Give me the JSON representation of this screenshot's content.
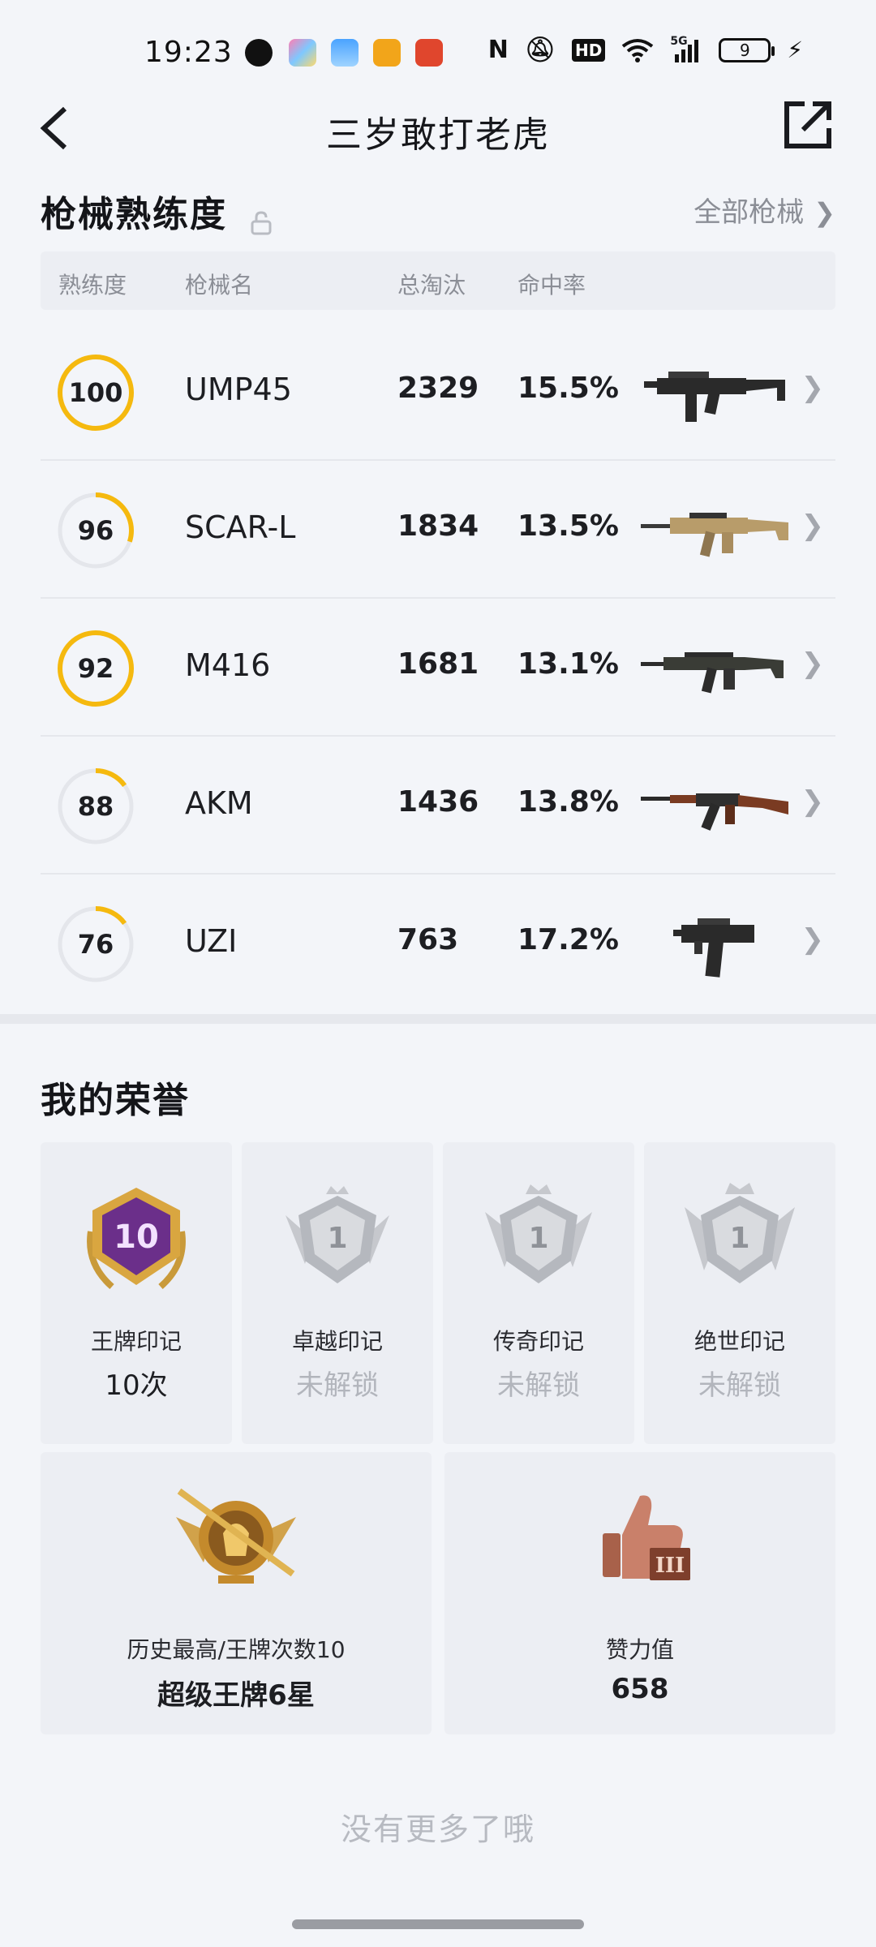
{
  "status_bar": {
    "time": "19:23",
    "hd": "HD",
    "net": "5G",
    "battery": "9"
  },
  "header": {
    "title": "三岁敢打老虎"
  },
  "mastery": {
    "title": "枪械熟练度",
    "all_link": "全部枪械",
    "columns": {
      "mastery": "熟练度",
      "name": "枪械名",
      "kills": "总淘汰",
      "hit_rate": "命中率"
    },
    "rows": [
      {
        "level": "100",
        "level_fraction": 1.0,
        "name": "UMP45",
        "kills": "2329",
        "hit_rate": "15.5%",
        "icon": "smg-ump45-icon"
      },
      {
        "level": "96",
        "level_fraction": 0.3,
        "name": "SCAR-L",
        "kills": "1834",
        "hit_rate": "13.5%",
        "icon": "rifle-scar-icon"
      },
      {
        "level": "92",
        "level_fraction": 1.0,
        "name": "M416",
        "kills": "1681",
        "hit_rate": "13.1%",
        "icon": "rifle-m416-icon"
      },
      {
        "level": "88",
        "level_fraction": 0.15,
        "name": "AKM",
        "kills": "1436",
        "hit_rate": "13.8%",
        "icon": "rifle-akm-icon"
      },
      {
        "level": "76",
        "level_fraction": 0.15,
        "name": "UZI",
        "kills": "763",
        "hit_rate": "17.2%",
        "icon": "smg-uzi-icon"
      }
    ]
  },
  "honors": {
    "title": "我的荣誉",
    "cards": [
      {
        "label": "王牌印记",
        "value": "10次",
        "badge_text": "10",
        "icon": "ace-mark-badge-icon"
      },
      {
        "label": "卓越印记",
        "value": "未解锁",
        "badge_text": "1",
        "icon": "excellence-mark-badge-icon"
      },
      {
        "label": "传奇印记",
        "value": "未解锁",
        "badge_text": "1",
        "icon": "legend-mark-badge-icon"
      },
      {
        "label": "绝世印记",
        "value": "未解锁",
        "badge_text": "1",
        "icon": "peerless-mark-badge-icon"
      }
    ],
    "big_cards": [
      {
        "label": "历史最高/王牌次数10",
        "value": "超级王牌6星",
        "icon": "super-ace-rank-icon"
      },
      {
        "label": "赞力值",
        "value": "658",
        "badge_text": "III",
        "icon": "thumbs-up-icon"
      }
    ]
  },
  "footer": {
    "no_more": "没有更多了哦"
  },
  "colors": {
    "ring_active": "#f5b90f",
    "ring_track": "#e4e6eb",
    "background": "#f3f5f9"
  }
}
